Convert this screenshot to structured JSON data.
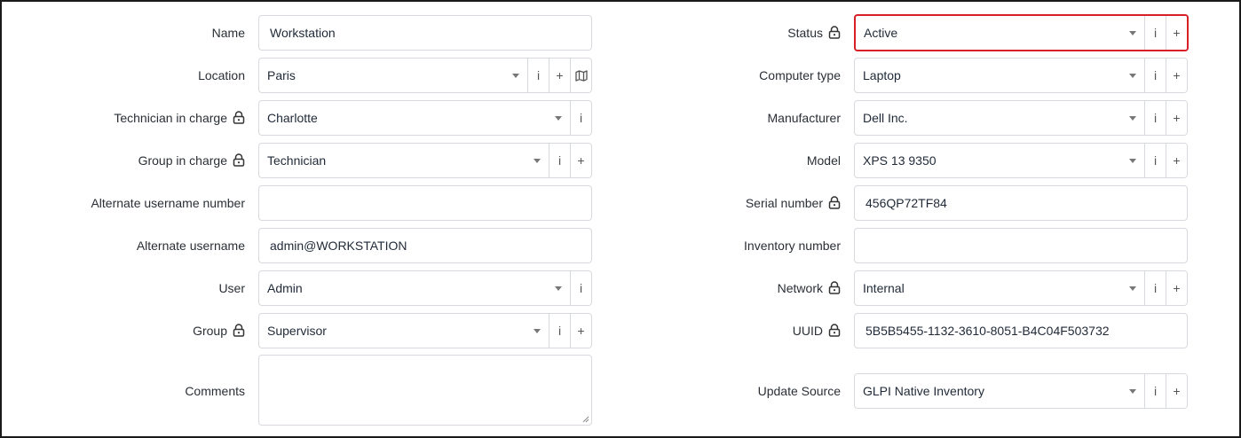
{
  "left": {
    "name": {
      "label": "Name",
      "value": "Workstation"
    },
    "location": {
      "label": "Location",
      "value": "Paris"
    },
    "technician": {
      "label": "Technician in charge",
      "value": "Charlotte"
    },
    "group_in_charge": {
      "label": "Group in charge",
      "value": "Technician"
    },
    "alt_username_number": {
      "label": "Alternate username number",
      "value": ""
    },
    "alt_username": {
      "label": "Alternate username",
      "value": "admin@WORKSTATION"
    },
    "user": {
      "label": "User",
      "value": "Admin"
    },
    "group": {
      "label": "Group",
      "value": "Supervisor"
    },
    "comments": {
      "label": "Comments",
      "value": ""
    }
  },
  "right": {
    "status": {
      "label": "Status",
      "value": "Active"
    },
    "computer_type": {
      "label": "Computer type",
      "value": "Laptop"
    },
    "manufacturer": {
      "label": "Manufacturer",
      "value": "Dell Inc."
    },
    "model": {
      "label": "Model",
      "value": "XPS 13 9350"
    },
    "serial": {
      "label": "Serial number",
      "value": "456QP72TF84"
    },
    "inventory": {
      "label": "Inventory number",
      "value": ""
    },
    "network": {
      "label": "Network",
      "value": "Internal"
    },
    "uuid": {
      "label": "UUID",
      "value": "5B5B5455-1132-3610-8051-B4C04F503732"
    },
    "update_source": {
      "label": "Update Source",
      "value": "GLPI Native Inventory"
    }
  },
  "icons": {
    "info": "i",
    "add": "+"
  },
  "colors": {
    "highlight_border": "#d81f26",
    "field_border": "#d6d9dd"
  }
}
